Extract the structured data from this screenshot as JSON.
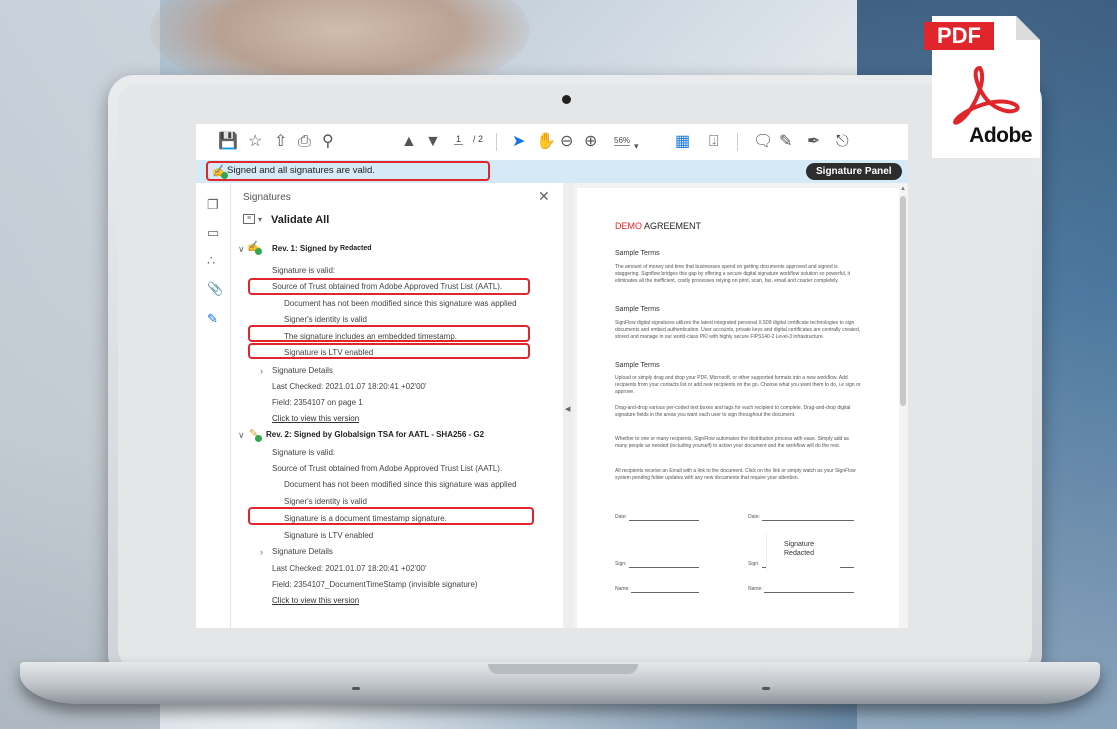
{
  "badge": {
    "pdf_label": "PDF",
    "brand": "Adobe"
  },
  "toolbar": {
    "page_current": "1",
    "page_total": "/ 2",
    "zoom": "56%"
  },
  "status_bar": {
    "message": "Signed and all signatures are valid.",
    "signature_panel_button": "Signature Panel"
  },
  "signatures_panel": {
    "title": "Signatures",
    "validate_all": "Validate All",
    "rev1": {
      "heading": "Rev. 1: Signed by",
      "signer": "Redacted",
      "lines": [
        "Signature is valid:",
        "Source of Trust obtained from Adobe Approved Trust List (AATL).",
        "Document has not been modified since this signature was applied",
        "Signer's identity is valid",
        "The signature includes an embedded timestamp.",
        "Signature is LTV enabled"
      ],
      "details": "Signature Details",
      "last_checked": "Last Checked: 2021.01.07 18:20:41 +02'00'",
      "field": "Field: 2354107 on page 1",
      "view_link": "Click to view this version"
    },
    "rev2": {
      "heading": "Rev. 2: Signed by Globalsign TSA for AATL - SHA256 - G2",
      "lines": [
        "Signature is valid:",
        "Source of Trust obtained from Adobe Approved Trust List (AATL).",
        "Document has not been modified since this signature was applied",
        "Signer's identity is valid",
        "Signature is a document timestamp signature.",
        "Signature is LTV enabled"
      ],
      "details": "Signature Details",
      "last_checked": "Last Checked: 2021.01.07 18:20:41 +02'00'",
      "field": "Field: 2354107_DocumentTimeStamp (invisible signature)",
      "view_link": "Click to view this version"
    }
  },
  "document": {
    "title_red": "DEMO",
    "title_rest": " AGREEMENT",
    "heading1": "Sample Terms",
    "para1": "The amount of money and time that businesses spend on getting documents approved and signed is staggering. Signflow bridges this gap by offering a secure digital signature workflow solution so powerful, it eliminates all the inefficient, costly processes relying on print, scan, fax, email and courier completely.",
    "heading2": "Sample Terms",
    "para2": "SignFlow digital signatures utilizes the latest integrated personal X.509 digital certificate technologies to sign documents and embed authentication. User accounts, private keys and digital certificates are centrally created, stored and manage in our world-class PKI with highly secure FIPS140-2 Level-3 infrastructure.",
    "heading3": "Sample Terms",
    "para3": "Upload or simply drag and drop your PDF, Microsoft, or other supported formats into a new workflow. Add recipients from your contacts list or add new recipients on the go. Choose what you want them to do, i.e sign or approve.",
    "para4": "Drag-and-drop various per-coded text boxes and tags for each recipient to complete. Drag-and-drop digital signature fields in the areas you want each user to sign throughout the document.",
    "para5": "Whether to one or many recipients, SignFlow automates the distribution process with ease. Simply add as many people as needed (including yourself) to action your document and the workflow will do the rest.",
    "para6": "All recipients receive an Email with a link to the document. Click on the link or simply watch as your SignFlow system pending folder updates with any new documents that require your attention.",
    "date_label": "Date:",
    "sign_label": "Sign:",
    "name_label": "Name:",
    "signature_box_line1": "Signature",
    "signature_box_line2": "Redacted"
  },
  "colors": {
    "accent": "#1473e6",
    "highlight_box": "#e0252b",
    "status_bar_bg": "#d6e9f7",
    "valid_green": "#2fa84f"
  }
}
